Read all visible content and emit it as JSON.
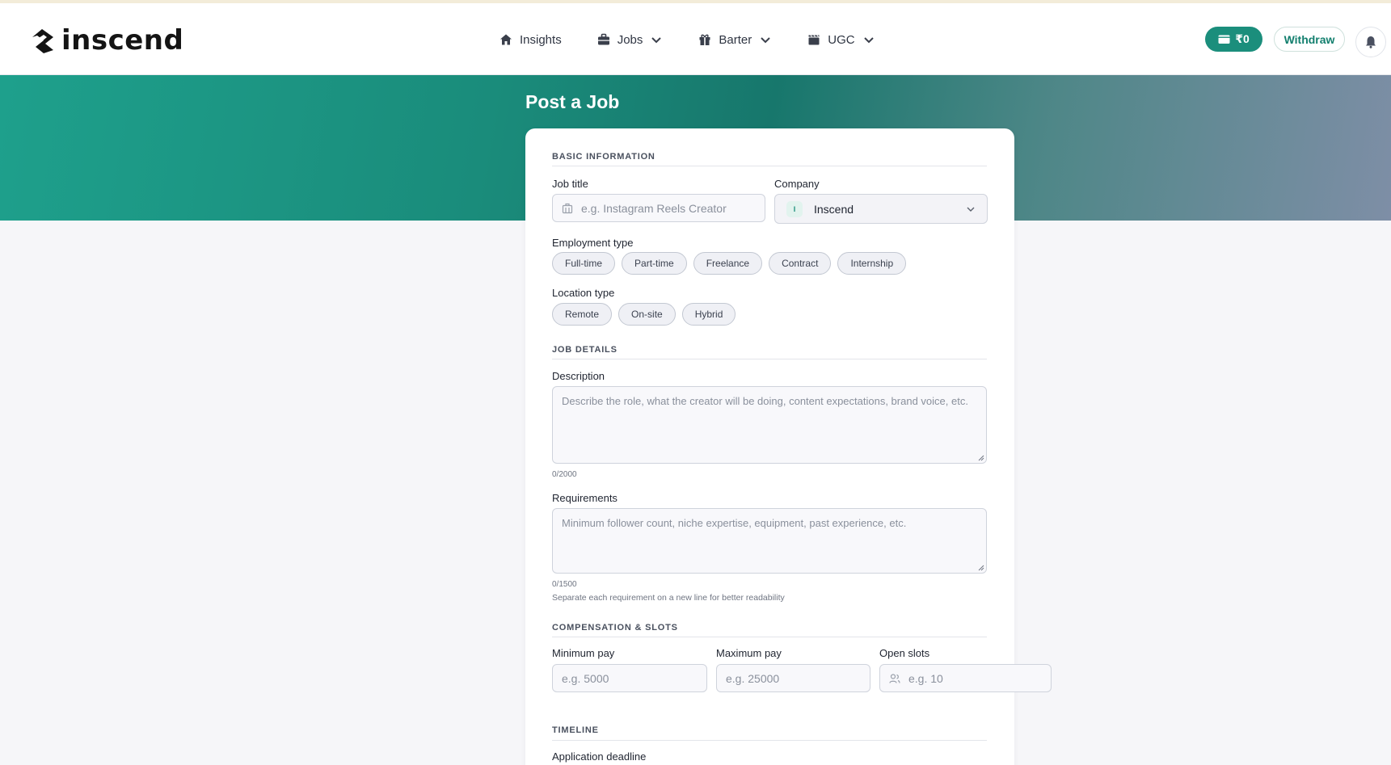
{
  "header": {
    "logo_text": "inscend",
    "nav": [
      {
        "label": "Insights",
        "icon": "home-icon",
        "dropdown": false
      },
      {
        "label": "Jobs",
        "icon": "briefcase-icon",
        "dropdown": true
      },
      {
        "label": "Barter",
        "icon": "gift-icon",
        "dropdown": true
      },
      {
        "label": "UGC",
        "icon": "clapperboard-icon",
        "dropdown": true
      }
    ],
    "wallet_balance": "₹0",
    "withdraw_label": "Withdraw"
  },
  "page": {
    "title": "Post a Job"
  },
  "form": {
    "basic": {
      "section_title": "BASIC INFORMATION",
      "job_title_label": "Job title",
      "job_title_placeholder": "e.g. Instagram Reels Creator",
      "company_label": "Company",
      "company_value": "Inscend",
      "company_badge": "I",
      "employment_label": "Employment type",
      "employment_options": [
        "Full-time",
        "Part-time",
        "Freelance",
        "Contract",
        "Internship"
      ],
      "location_label": "Location type",
      "location_options": [
        "Remote",
        "On-site",
        "Hybrid"
      ]
    },
    "details": {
      "section_title": "JOB DETAILS",
      "description_label": "Description",
      "description_placeholder": "Describe the role, what the creator will be doing, content expectations, brand voice, etc.",
      "description_counter": "0/2000",
      "requirements_label": "Requirements",
      "requirements_placeholder": "Minimum follower count, niche expertise, equipment, past experience, etc.",
      "requirements_counter": "0/1500",
      "requirements_hint": "Separate each requirement on a new line for better readability"
    },
    "compensation": {
      "section_title": "COMPENSATION & SLOTS",
      "min_pay_label": "Minimum pay",
      "min_pay_placeholder": "e.g. 5000",
      "max_pay_label": "Maximum pay",
      "max_pay_placeholder": "e.g. 25000",
      "slots_label": "Open slots",
      "slots_placeholder": "e.g. 10"
    },
    "timeline": {
      "section_title": "TIMELINE",
      "deadline_label": "Application deadline"
    }
  },
  "colors": {
    "accent": "#1b8e7c",
    "hero_start": "#1ea08c",
    "hero_end": "#7e8ea6"
  }
}
